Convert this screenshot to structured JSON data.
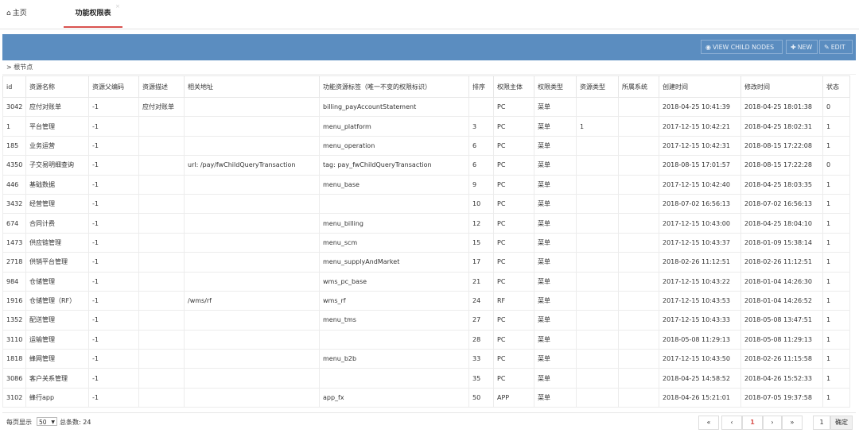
{
  "tabs": {
    "home_label": "主页",
    "active_label": "功能权限表"
  },
  "toolbar": {
    "view_child_label": "VIEW CHILD NODES",
    "new_label": "NEW",
    "edit_label": "EDIT"
  },
  "breadcrumb": "> 根节点",
  "table": {
    "headers": [
      "id",
      "资源名称",
      "资源父编码",
      "资源描述",
      "相关地址",
      "功能资源标签（唯一不变的权限标识）",
      "排序",
      "权限主体",
      "权限类型",
      "资源类型",
      "所属系统",
      "创建时间",
      "修改时间",
      "状态"
    ],
    "rows": [
      [
        "3042",
        "应付对账单",
        "-1",
        "应付对账单",
        "",
        "billing_payAccountStatement",
        "",
        "PC",
        "菜单",
        "",
        "",
        "2018-04-25 10:41:39",
        "2018-04-25 18:01:38",
        "0"
      ],
      [
        "1",
        "平台管理",
        "-1",
        "",
        "",
        "menu_platform",
        "3",
        "PC",
        "菜单",
        "1",
        "",
        "2017-12-15 10:42:21",
        "2018-04-25 18:02:31",
        "1"
      ],
      [
        "185",
        "业务运营",
        "-1",
        "",
        "",
        "menu_operation",
        "6",
        "PC",
        "菜单",
        "",
        "",
        "2017-12-15 10:42:31",
        "2018-08-15 17:22:08",
        "1"
      ],
      [
        "4350",
        "子交易明细查询",
        "-1",
        "",
        "url: /pay/fwChildQueryTransaction",
        "tag: pay_fwChildQueryTransaction",
        "6",
        "PC",
        "菜单",
        "",
        "",
        "2018-08-15 17:01:57",
        "2018-08-15 17:22:28",
        "0"
      ],
      [
        "446",
        "基础数据",
        "-1",
        "",
        "",
        "menu_base",
        "9",
        "PC",
        "菜单",
        "",
        "",
        "2017-12-15 10:42:40",
        "2018-04-25 18:03:35",
        "1"
      ],
      [
        "3432",
        "经营管理",
        "-1",
        "",
        "",
        "",
        "10",
        "PC",
        "菜单",
        "",
        "",
        "2018-07-02 16:56:13",
        "2018-07-02 16:56:13",
        "1"
      ],
      [
        "674",
        "合同计费",
        "-1",
        "",
        "",
        "menu_billing",
        "12",
        "PC",
        "菜单",
        "",
        "",
        "2017-12-15 10:43:00",
        "2018-04-25 18:04:10",
        "1"
      ],
      [
        "1473",
        "供应链管理",
        "-1",
        "",
        "",
        "menu_scm",
        "15",
        "PC",
        "菜单",
        "",
        "",
        "2017-12-15 10:43:37",
        "2018-01-09 15:38:14",
        "1"
      ],
      [
        "2718",
        "供销平台管理",
        "-1",
        "",
        "",
        "menu_supplyAndMarket",
        "17",
        "PC",
        "菜单",
        "",
        "",
        "2018-02-26 11:12:51",
        "2018-02-26 11:12:51",
        "1"
      ],
      [
        "984",
        "仓储管理",
        "-1",
        "",
        "",
        "wms_pc_base",
        "21",
        "PC",
        "菜单",
        "",
        "",
        "2017-12-15 10:43:22",
        "2018-01-04 14:26:30",
        "1"
      ],
      [
        "1916",
        "仓储管理（RF）",
        "-1",
        "",
        "/wms/rf",
        "wms_rf",
        "24",
        "RF",
        "菜单",
        "",
        "",
        "2017-12-15 10:43:53",
        "2018-01-04 14:26:52",
        "1"
      ],
      [
        "1352",
        "配送管理",
        "-1",
        "",
        "",
        "menu_tms",
        "27",
        "PC",
        "菜单",
        "",
        "",
        "2017-12-15 10:43:33",
        "2018-05-08 13:47:51",
        "1"
      ],
      [
        "3110",
        "运输管理",
        "-1",
        "",
        "",
        "",
        "28",
        "PC",
        "菜单",
        "",
        "",
        "2018-05-08 11:29:13",
        "2018-05-08 11:29:13",
        "1"
      ],
      [
        "1818",
        "蜂网管理",
        "-1",
        "",
        "",
        "menu_b2b",
        "33",
        "PC",
        "菜单",
        "",
        "",
        "2017-12-15 10:43:50",
        "2018-02-26 11:15:58",
        "1"
      ],
      [
        "3086",
        "客户关系管理",
        "-1",
        "",
        "",
        "",
        "35",
        "PC",
        "菜单",
        "",
        "",
        "2018-04-25 14:58:52",
        "2018-04-26 15:52:33",
        "1"
      ],
      [
        "3102",
        "蜂行app",
        "-1",
        "",
        "",
        "app_fx",
        "50",
        "APP",
        "菜单",
        "",
        "",
        "2018-04-26 15:21:01",
        "2018-07-05 19:37:58",
        "1"
      ]
    ]
  },
  "footer": {
    "page_size_label": "每页显示",
    "page_size_value": "50",
    "total_label": "总条数: 24",
    "first": "«",
    "prev": "‹",
    "current_page": "1",
    "next": "›",
    "last": "»",
    "jump_value": "1",
    "go_label": "确定"
  }
}
